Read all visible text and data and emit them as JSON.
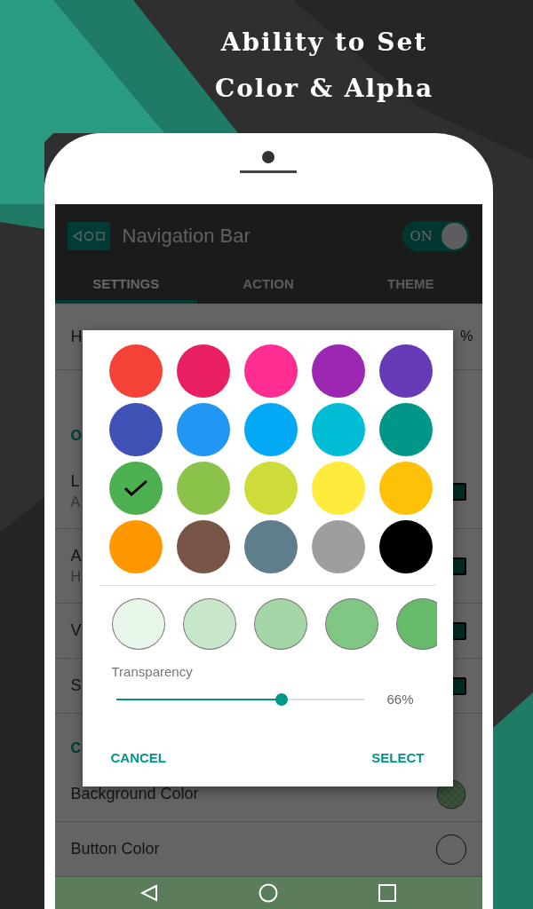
{
  "headline": [
    "Ability to Set",
    "Color & Alpha"
  ],
  "app_bar": {
    "title": "Navigation Bar",
    "switch": {
      "label": "ON",
      "on": true
    }
  },
  "tabs": [
    {
      "label": "SETTINGS",
      "selected": true
    },
    {
      "label": "ACTION",
      "selected": false
    },
    {
      "label": "THEME",
      "selected": false
    }
  ],
  "list": [
    {
      "kind": "value",
      "title": "H",
      "value": "%"
    },
    {
      "kind": "header",
      "title": "O"
    },
    {
      "kind": "checkbox",
      "title": "L",
      "subtitle": "A",
      "checked": true
    },
    {
      "kind": "checkbox",
      "title": "A",
      "subtitle": "H",
      "checked": true
    },
    {
      "kind": "checkbox",
      "title": "V",
      "checked": true
    },
    {
      "kind": "checkbox",
      "title": "S",
      "checked": true
    },
    {
      "kind": "header",
      "title": "C"
    },
    {
      "kind": "swatch",
      "title": "Background Color"
    },
    {
      "kind": "empty_swatch",
      "title": "Button Color"
    }
  ],
  "dialog": {
    "colors": [
      {
        "color": "#f44336",
        "selected": false
      },
      {
        "color": "#e91e63",
        "selected": false
      },
      {
        "color": "#ff2d92",
        "selected": false
      },
      {
        "color": "#9c27b0",
        "selected": false
      },
      {
        "color": "#673ab7",
        "selected": false
      },
      {
        "color": "#3f51b5",
        "selected": false
      },
      {
        "color": "#2196f3",
        "selected": false
      },
      {
        "color": "#03a9f4",
        "selected": false
      },
      {
        "color": "#00bcd4",
        "selected": false
      },
      {
        "color": "#009688",
        "selected": false
      },
      {
        "color": "#4caf50",
        "selected": true
      },
      {
        "color": "#8bc34a",
        "selected": false
      },
      {
        "color": "#cddc39",
        "selected": false
      },
      {
        "color": "#ffeb3b",
        "selected": false
      },
      {
        "color": "#ffc107",
        "selected": false
      },
      {
        "color": "#ff9800",
        "selected": false
      },
      {
        "color": "#795548",
        "selected": false
      },
      {
        "color": "#607d8b",
        "selected": false
      },
      {
        "color": "#9e9e9e",
        "selected": false
      },
      {
        "color": "#000000",
        "selected": false
      }
    ],
    "shades": [
      {
        "color": "#e8f5e9"
      },
      {
        "color": "#c8e6c9"
      },
      {
        "color": "#a5d6a7"
      },
      {
        "color": "#81c784"
      },
      {
        "color": "#66bb6a"
      }
    ],
    "transparency": {
      "label": "Transparency",
      "level": 0.667,
      "reading": "66%"
    },
    "buttons": [
      "CANCEL",
      "SELECT"
    ]
  }
}
